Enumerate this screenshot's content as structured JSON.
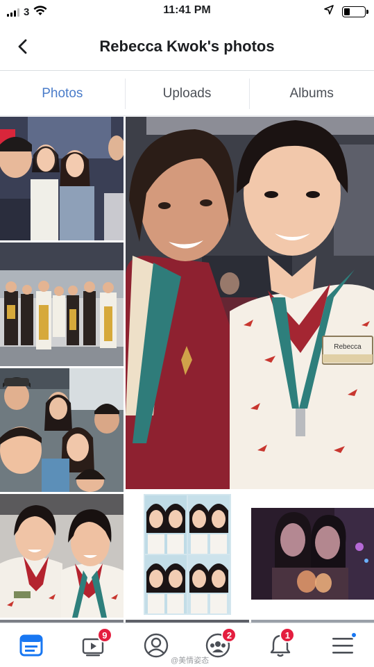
{
  "status_bar": {
    "carrier": "3",
    "time": "11:41 PM"
  },
  "header": {
    "title": "Rebecca Kwok's photos"
  },
  "tabs": [
    {
      "label": "Photos",
      "active": true
    },
    {
      "label": "Uploads",
      "active": false
    },
    {
      "label": "Albums",
      "active": false
    }
  ],
  "photos": [
    {
      "name": "photo-group-selfie-event"
    },
    {
      "name": "photo-featured-selfie-flight-attendants"
    },
    {
      "name": "photo-costume-group"
    },
    {
      "name": "photo-group-selfie-friends"
    },
    {
      "name": "photo-selfie-two-flight-attendants"
    },
    {
      "name": "photo-collage"
    },
    {
      "name": "photo-night-drinks"
    }
  ],
  "featured_photo": {
    "badge_name": "Rebecca"
  },
  "bottom_nav": {
    "items": [
      {
        "icon": "news-feed-icon",
        "active": true,
        "badge": ""
      },
      {
        "icon": "watch-icon",
        "active": false,
        "badge": "9"
      },
      {
        "icon": "profile-icon",
        "active": false,
        "badge": ""
      },
      {
        "icon": "groups-icon",
        "active": false,
        "badge": "2"
      },
      {
        "icon": "notifications-icon",
        "active": false,
        "badge": "1"
      },
      {
        "icon": "menu-icon",
        "active": false,
        "badge": ""
      }
    ]
  },
  "watermark": "@美情姿态",
  "colors": {
    "accent": "#4a7cc9",
    "facebook_blue": "#1877f2",
    "badge_red": "#e41e3f"
  }
}
